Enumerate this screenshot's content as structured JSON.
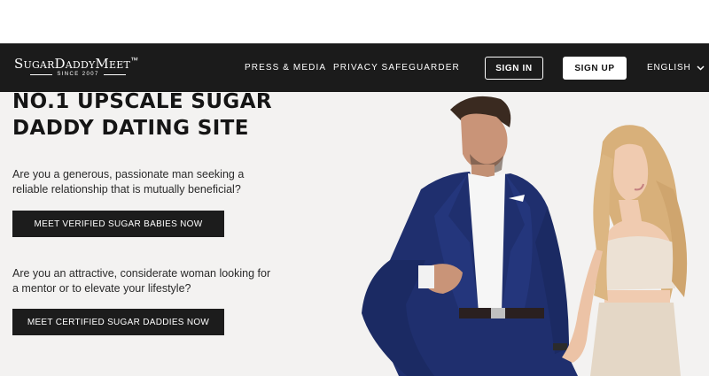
{
  "header": {
    "logo_text": "SugarDaddyMeet",
    "logo_mark": "™",
    "logo_since": "SINCE 2007",
    "nav": [
      {
        "label": "PRESS & MEDIA"
      },
      {
        "label": "PRIVACY SAFEGUARDER"
      }
    ],
    "sign_in_label": "SIGN IN",
    "sign_up_label": "SIGN UP",
    "language_label": "ENGLISH",
    "language_icon": "chevron-down-icon"
  },
  "hero": {
    "headline_line1": "NO.1 UPSCALE SUGAR",
    "headline_line2": "DADDY DATING SITE",
    "question_men": "Are you a generous, passionate man seeking a reliable relationship that is mutually beneficial?",
    "cta_men": "MEET VERIFIED SUGAR BABIES NOW",
    "question_women": "Are you an attractive, considerate woman looking for a mentor or to elevate your lifestyle?",
    "cta_women": "MEET CERTIFIED SUGAR DADDIES NOW"
  },
  "colors": {
    "header_bg": "#1b1b1b",
    "hero_bg": "#f3f2f1",
    "button_dark": "#1c1c1c",
    "suit_blue": "#1f2f6e"
  }
}
